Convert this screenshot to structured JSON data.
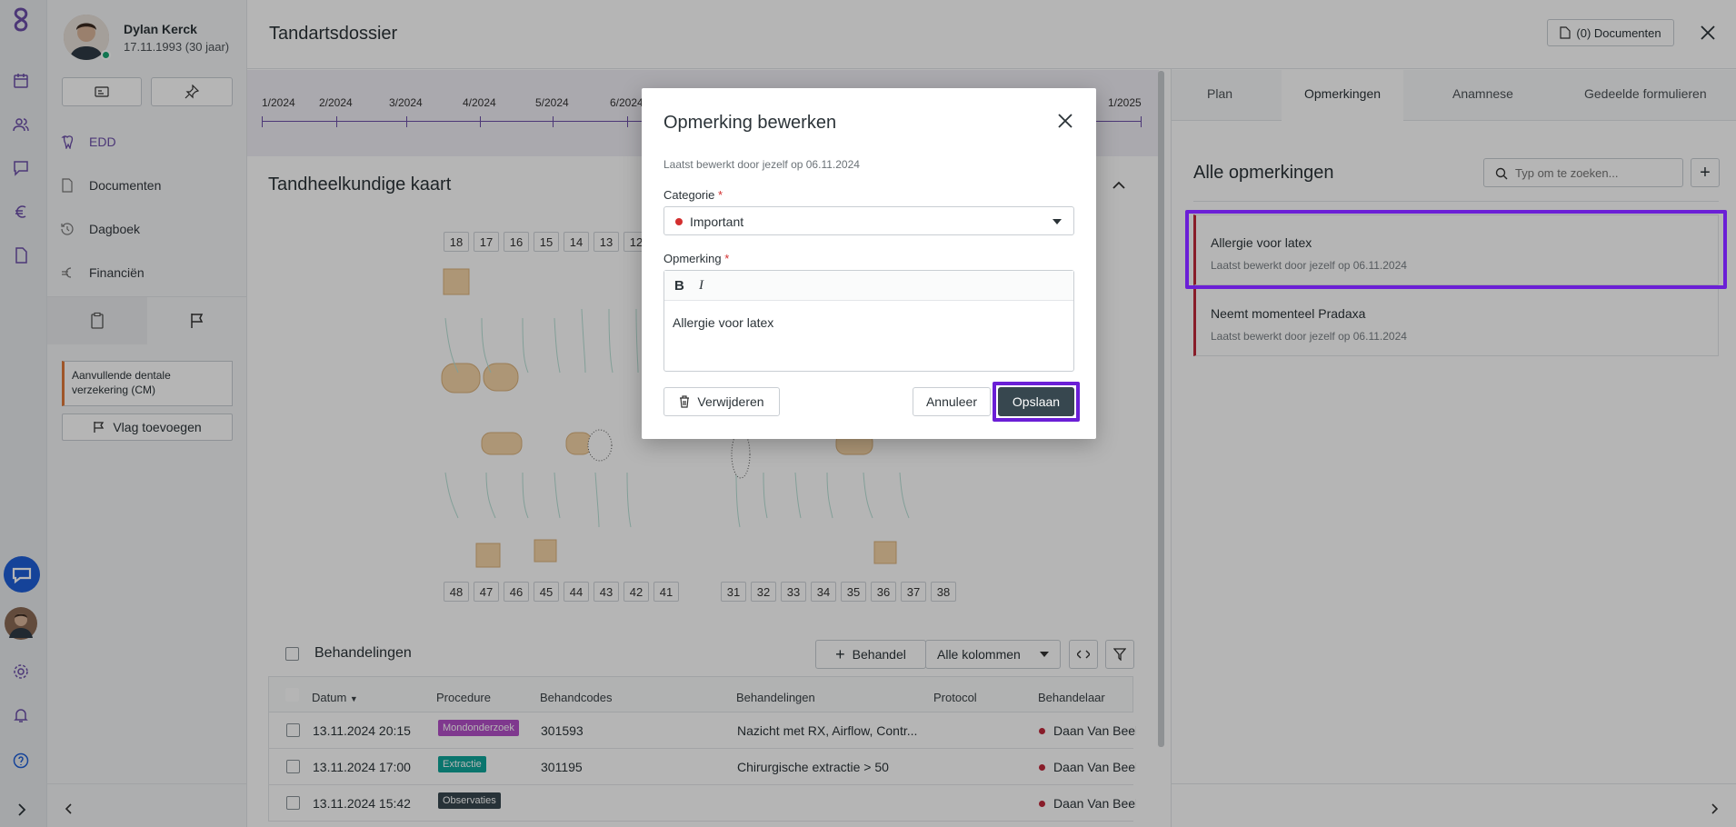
{
  "patient": {
    "name": "Dylan Kerck",
    "dob": "17.11.1993 (30 jaar)"
  },
  "nav": [
    {
      "label": "EDD",
      "icon": "tooth-icon",
      "active": true
    },
    {
      "label": "Documenten",
      "icon": "document-icon"
    },
    {
      "label": "Dagboek",
      "icon": "history-icon"
    },
    {
      "label": "Financiën",
      "icon": "euro-icon"
    }
  ],
  "flag_note": "Aanvullende dentale verzekering (CM)",
  "add_flag_label": "Vlag toevoegen",
  "header": {
    "title": "Tandartsdossier",
    "documents_button": "(0) Documenten"
  },
  "timeline": [
    "1/2024",
    "2/2024",
    "3/2024",
    "4/2024",
    "5/2024",
    "6/2024",
    "1/2025"
  ],
  "dental_chart": {
    "title": "Tandheelkundige kaart",
    "upper_numbers": [
      "18",
      "17",
      "16",
      "15",
      "14",
      "13",
      "12"
    ],
    "lower_left_numbers": [
      "48",
      "47",
      "46",
      "45",
      "44",
      "43",
      "42",
      "41"
    ],
    "lower_right_numbers": [
      "31",
      "32",
      "33",
      "34",
      "35",
      "36",
      "37",
      "38"
    ]
  },
  "treatments": {
    "title": "Behandelingen",
    "add_button": "Behandel",
    "columns_select": "Alle kolommen",
    "headers": [
      "Datum",
      "Procedure",
      "Behandcodes",
      "Behandelingen",
      "Protocol",
      "Behandelaar"
    ],
    "rows": [
      {
        "date": "13.11.2024 20:15",
        "procedure": "Mondonderzoek",
        "color": "#b44fc9",
        "code": "301593",
        "treatment": "Nazicht met RX, Airflow, Contr...",
        "practitioner": "Daan Van Beek"
      },
      {
        "date": "13.11.2024 17:00",
        "procedure": "Extractie",
        "color": "#0fa59a",
        "code": "301195",
        "treatment": "Chirurgische extractie > 50",
        "practitioner": "Daan Van Beek"
      },
      {
        "date": "13.11.2024 15:42",
        "procedure": "Observaties",
        "color": "#37474f",
        "code": "",
        "treatment": "",
        "practitioner": "Daan Van Beek"
      }
    ]
  },
  "right_panel": {
    "tabs": [
      "Plan",
      "Opmerkingen",
      "Anamnese",
      "Gedeelde formulieren"
    ],
    "active_tab": "Opmerkingen",
    "title": "Alle opmerkingen",
    "search_placeholder": "Typ om te zoeken...",
    "notes": [
      {
        "title": "Allergie voor latex",
        "meta": "Laatst bewerkt door jezelf op 06.11.2024"
      },
      {
        "title": "Neemt momenteel Pradaxa",
        "meta": "Laatst bewerkt door jezelf op 06.11.2024"
      }
    ]
  },
  "modal": {
    "title": "Opmerking bewerken",
    "meta": "Laatst bewerkt door jezelf op 06.11.2024",
    "category_label": "Categorie",
    "category_value": "Important",
    "note_label": "Opmerking",
    "note_value": "Allergie voor latex",
    "required_mark": "*",
    "bold_label": "B",
    "italic_label": "I",
    "delete_button": "Verwijderen",
    "cancel_button": "Annuleer",
    "save_button": "Opslaan"
  },
  "colors": {
    "accent": "#6b4ea8",
    "highlight": "#6b1fd6",
    "save_button": "#37474f",
    "important_dot": "#d32f2f"
  }
}
